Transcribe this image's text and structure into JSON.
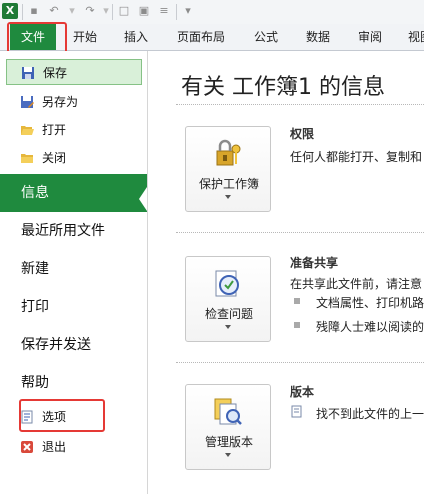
{
  "quick_access": {
    "app_icon": "excel-icon",
    "icons": [
      "save-icon",
      "undo-icon",
      "redo-icon",
      "new-document-icon",
      "print-preview-icon",
      "form-icon",
      "customize-icon"
    ]
  },
  "ribbon_tabs": [
    "文件",
    "开始",
    "插入",
    "页面布局",
    "公式",
    "数据",
    "审阅",
    "视图"
  ],
  "sidebar": {
    "top_items": [
      {
        "label": "保存",
        "icon": "save-icon"
      },
      {
        "label": "另存为",
        "icon": "save-as-icon"
      },
      {
        "label": "打开",
        "icon": "open-folder-icon"
      },
      {
        "label": "关闭",
        "icon": "close-folder-icon"
      }
    ],
    "big_items": [
      "信息",
      "最近所用文件",
      "新建",
      "打印",
      "保存并发送",
      "帮助"
    ],
    "bottom_items": [
      {
        "label": "选项",
        "icon": "options-icon"
      },
      {
        "label": "退出",
        "icon": "exit-icon"
      }
    ],
    "active": "信息"
  },
  "main": {
    "title": "有关 工作簿1 的信息",
    "sections": [
      {
        "button": "保护工作簿",
        "icon": "lock-key-icon",
        "heading": "权限",
        "text": "任何人都能打开、复制和"
      },
      {
        "button": "检查问题",
        "icon": "inspect-document-icon",
        "heading": "准备共享",
        "text": "在共享此文件前，请注意",
        "bullets": [
          "文档属性、打印机路",
          "残障人士难以阅读的"
        ]
      },
      {
        "button": "管理版本",
        "icon": "versions-icon",
        "heading": "版本",
        "text": "找不到此文件的上一"
      }
    ]
  },
  "colors": {
    "accent": "#1f8a3e",
    "highlight_box": "#e53935"
  }
}
